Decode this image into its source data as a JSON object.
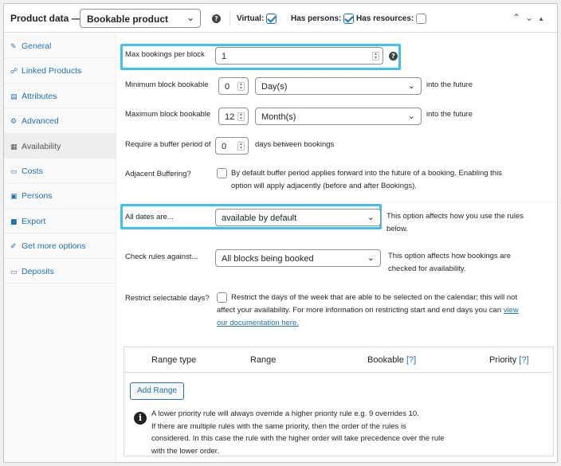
{
  "header": {
    "title": "Product data —",
    "product_type": "Bookable product",
    "help_icon": "?",
    "options": [
      {
        "label": "Virtual:",
        "checked": true
      },
      {
        "label": "Has persons:",
        "checked": true
      },
      {
        "label": "Has resources:",
        "checked": false
      }
    ]
  },
  "sidebar": {
    "items": [
      {
        "label": "General",
        "icon": "wrench-icon",
        "glyph": "✎"
      },
      {
        "label": "Linked Products",
        "icon": "link-icon",
        "glyph": "☍"
      },
      {
        "label": "Attributes",
        "icon": "list-icon",
        "glyph": "▤"
      },
      {
        "label": "Advanced",
        "icon": "gear-icon",
        "glyph": "⚙"
      },
      {
        "label": "Availability",
        "icon": "calendar-icon",
        "glyph": "▦",
        "active": true
      },
      {
        "label": "Costs",
        "icon": "card-icon",
        "glyph": "▭"
      },
      {
        "label": "Persons",
        "icon": "person-icon",
        "glyph": "▣"
      },
      {
        "label": "Export",
        "icon": "export-icon",
        "glyph": "■"
      },
      {
        "label": "Get more options",
        "icon": "plugin-icon",
        "glyph": "✐"
      },
      {
        "label": "Deposits",
        "icon": "card-icon",
        "glyph": "▭"
      }
    ]
  },
  "fields": {
    "max_bookings": {
      "label": "Max bookings per block",
      "value": "1"
    },
    "min_block": {
      "label": "Minimum block bookable",
      "value": "0",
      "unit": "Day(s)",
      "suffix": "into the future"
    },
    "max_block": {
      "label": "Maximum block bookable",
      "value": "12",
      "unit": "Month(s)",
      "suffix": "into the future"
    },
    "buffer": {
      "label": "Require a buffer period of",
      "value": "0",
      "suffix": "days between bookings"
    },
    "adjacent": {
      "label": "Adjacent Buffering?",
      "checked": false,
      "desc_line1": "By default buffer period applies forward into the future of a booking. Enabling this",
      "desc_line2": "option will apply adjacently (before and after Bookings)."
    },
    "all_dates": {
      "label": "All dates are...",
      "value": "available by default",
      "desc_line1": "This option affects how you use the rules",
      "desc_line2": "below."
    },
    "check_rules": {
      "label": "Check rules against...",
      "value": "All blocks being booked",
      "desc_line1": "This option affects how bookings are",
      "desc_line2": "checked for availability."
    },
    "restrict": {
      "label": "Restrict selectable days?",
      "checked": false,
      "desc_line1": "Restrict the days of the week that are able to be selected on the calendar; this will not",
      "desc_line2_pre": "affect your availability. For more information on restricting start and end days you can ",
      "link1": "view",
      "link2": "our documentation here."
    }
  },
  "ranges": {
    "headers": {
      "range_type": "Range type",
      "range": "Range",
      "bookable": "Bookable",
      "priority": "Priority",
      "help": "[?]"
    },
    "add_button": "Add Range",
    "info_icon": "i",
    "info_lines": [
      "A lower priority rule will always override a higher priority rule e.g. 9 overrides 10.",
      "If there are multiple rules with the same priority, then the order of the rules is",
      "considered. In this case the rule with the higher order will take precedence over the rule",
      "with the lower order."
    ]
  },
  "colors": {
    "accent": "#2271b1",
    "highlight": "#3fc1f0"
  }
}
